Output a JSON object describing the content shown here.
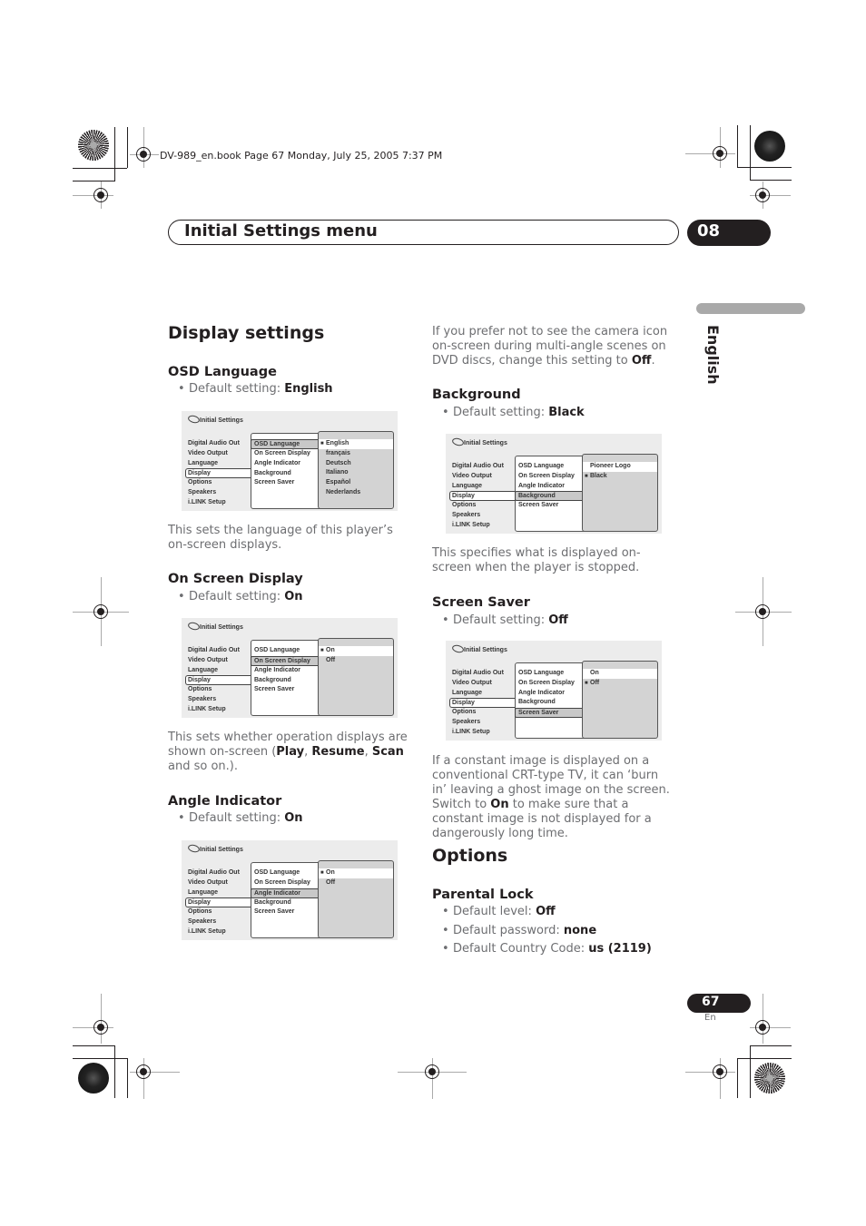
{
  "slug": "DV-989_en.book  Page 67  Monday, July 25, 2005  7:37 PM",
  "header": {
    "title": "Initial Settings menu",
    "chapter": "08"
  },
  "language_tab": "English",
  "footer": {
    "page": "67",
    "lang": "En"
  },
  "display_settings": {
    "title": "Display settings",
    "osd_language": {
      "heading": "OSD Language",
      "default_label": "Default setting: ",
      "default_value": "English",
      "description": "This sets the language of this player’s on-screen displays."
    },
    "on_screen_display": {
      "heading": "On Screen Display",
      "default_label": "Default setting: ",
      "default_value": "On",
      "desc_pre": "This sets whether operation displays are shown on-screen (",
      "desc_b1": "Play",
      "desc_sep1": ", ",
      "desc_b2": "Resume",
      "desc_sep2": ", ",
      "desc_b3": "Scan",
      "desc_post": " and so on.)."
    },
    "angle_indicator": {
      "heading": "Angle Indicator",
      "default_label": "Default setting: ",
      "default_value": "On",
      "desc_pre": "If you prefer not to see the camera icon on-screen during multi-angle scenes on DVD discs, change this setting to ",
      "desc_b": "Off",
      "desc_post": "."
    },
    "background": {
      "heading": "Background",
      "default_label": "Default setting: ",
      "default_value": "Black",
      "description": "This specifies what is displayed on-screen when the player is stopped."
    },
    "screen_saver": {
      "heading": "Screen Saver",
      "default_label": "Default setting: ",
      "default_value": "Off",
      "desc_pre": "If a constant image is displayed on a conventional CRT-type TV, it can ‘burn in’ leaving a ghost image on the screen. Switch to ",
      "desc_b": "On",
      "desc_post": " to make sure that a constant image is not displayed for a dangerously long time."
    }
  },
  "options": {
    "title": "Options",
    "parental_lock": {
      "heading": "Parental Lock",
      "bullets": [
        {
          "label": "Default level: ",
          "value": "Off"
        },
        {
          "label": "Default password: ",
          "value": "none"
        },
        {
          "label": "Default Country Code: ",
          "value": "us (2119)"
        }
      ]
    }
  },
  "osd_menu": {
    "title": "Initial Settings",
    "main_items": [
      "Digital Audio Out",
      "Video Output",
      "Language",
      "Display",
      "Options",
      "Speakers",
      "i.LINK Setup"
    ],
    "display_items": [
      "OSD Language",
      "On Screen Display",
      "Angle Indicator",
      "Background",
      "Screen Saver"
    ],
    "screens": [
      {
        "name": "osd-language",
        "highlight": 0,
        "options": [
          "English",
          "français",
          "Deutsch",
          "Italiano",
          "Español",
          "Nederlands"
        ],
        "selected": 0
      },
      {
        "name": "on-screen-display",
        "highlight": 1,
        "options": [
          "On",
          "Off"
        ],
        "selected": 0
      },
      {
        "name": "angle-indicator",
        "highlight": 2,
        "options": [
          "On",
          "Off"
        ],
        "selected": 0
      },
      {
        "name": "background",
        "highlight": 3,
        "options": [
          "Pioneer Logo",
          "Black"
        ],
        "selected": 1
      },
      {
        "name": "screen-saver",
        "highlight": 4,
        "options": [
          "On",
          "Off"
        ],
        "selected": 1
      }
    ]
  }
}
